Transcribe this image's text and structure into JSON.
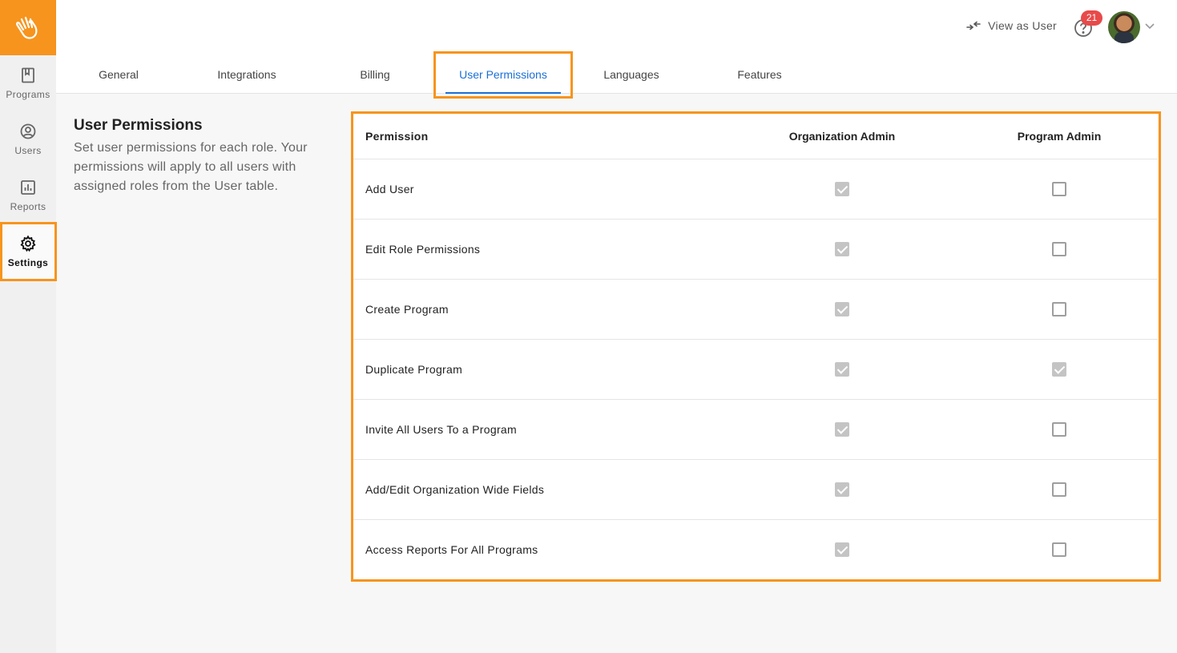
{
  "sidebar": {
    "items": [
      {
        "label": "Programs",
        "icon": "book-icon"
      },
      {
        "label": "Users",
        "icon": "user-circle-icon"
      },
      {
        "label": "Reports",
        "icon": "bar-chart-icon"
      },
      {
        "label": "Settings",
        "icon": "gear-icon",
        "active": true
      }
    ]
  },
  "header": {
    "view_as_user": "View as User",
    "notification_count": "21"
  },
  "tabs": [
    {
      "label": "General"
    },
    {
      "label": "Integrations"
    },
    {
      "label": "Billing"
    },
    {
      "label": "User Permissions",
      "active": true
    },
    {
      "label": "Languages"
    },
    {
      "label": "Features"
    }
  ],
  "section": {
    "title": "User Permissions",
    "description": "Set user permissions for each role. Your permissions will apply to all users with assigned roles from the User table."
  },
  "table": {
    "columns": [
      "Permission",
      "Organization Admin",
      "Program Admin"
    ],
    "rows": [
      {
        "permission": "Add User",
        "org_admin": true,
        "program_admin": false
      },
      {
        "permission": "Edit Role Permissions",
        "org_admin": true,
        "program_admin": false
      },
      {
        "permission": "Create Program",
        "org_admin": true,
        "program_admin": false
      },
      {
        "permission": "Duplicate Program",
        "org_admin": true,
        "program_admin": true
      },
      {
        "permission": "Invite All Users To a Program",
        "org_admin": true,
        "program_admin": false
      },
      {
        "permission": "Add/Edit Organization Wide Fields",
        "org_admin": true,
        "program_admin": false
      },
      {
        "permission": "Access Reports For All Programs",
        "org_admin": true,
        "program_admin": false
      }
    ]
  },
  "colors": {
    "brand": "#f7941d",
    "tab_active": "#1a6fd6",
    "badge": "#e84a4a",
    "checkbox_checked": "#c4c4c4"
  }
}
